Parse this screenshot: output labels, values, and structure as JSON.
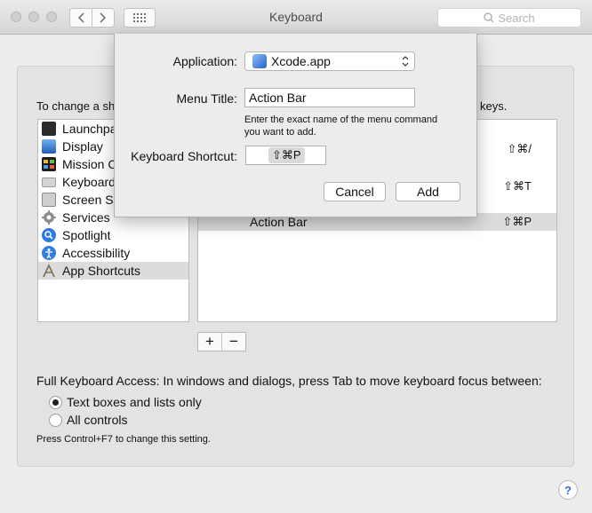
{
  "window": {
    "title": "Keyboard",
    "search_placeholder": "Search"
  },
  "panel": {
    "instruction_left": "To change a sh",
    "instruction_right": "keys."
  },
  "sidebar": {
    "items": [
      {
        "label": "Launchpa",
        "icon": "launchpad-icon"
      },
      {
        "label": "Display",
        "icon": "display-icon"
      },
      {
        "label": "Mission C",
        "icon": "mission-control-icon"
      },
      {
        "label": "Keyboard",
        "icon": "keyboard-icon"
      },
      {
        "label": "Screen Sh",
        "icon": "screenshot-icon"
      },
      {
        "label": "Services",
        "icon": "services-gear-icon"
      },
      {
        "label": "Spotlight",
        "icon": "spotlight-icon"
      },
      {
        "label": "Accessibility",
        "icon": "accessibility-icon"
      },
      {
        "label": "App Shortcuts",
        "icon": "app-shortcuts-icon"
      }
    ],
    "selected_index": 8
  },
  "shortcuts": {
    "rows": [
      {
        "name": "",
        "shortcut": "⇧⌘/"
      },
      {
        "name": "",
        "shortcut": "⇧⌘T"
      },
      {
        "name": "Action Bar",
        "shortcut": "⇧⌘P"
      }
    ]
  },
  "controls": {
    "add_symbol": "+",
    "remove_symbol": "−"
  },
  "keyboard_access": {
    "label": "Full Keyboard Access: In windows and dialogs, press Tab to move keyboard focus between:",
    "options": [
      {
        "label": "Text boxes and lists only",
        "selected": true
      },
      {
        "label": "All controls",
        "selected": false
      }
    ],
    "note": "Press Control+F7 to change this setting."
  },
  "help": {
    "symbol": "?"
  },
  "dialog": {
    "application_label": "Application:",
    "application_value": "Xcode.app",
    "menu_title_label": "Menu Title:",
    "menu_title_value": "Action Bar",
    "hint_line1": "Enter the exact name of the menu command",
    "hint_line2": "you want to add.",
    "shortcut_label": "Keyboard Shortcut:",
    "shortcut_value": "⇧⌘P",
    "cancel_label": "Cancel",
    "add_label": "Add"
  },
  "colors": {
    "selection": "#dcdcdc",
    "accent": "#2a6fd8"
  }
}
